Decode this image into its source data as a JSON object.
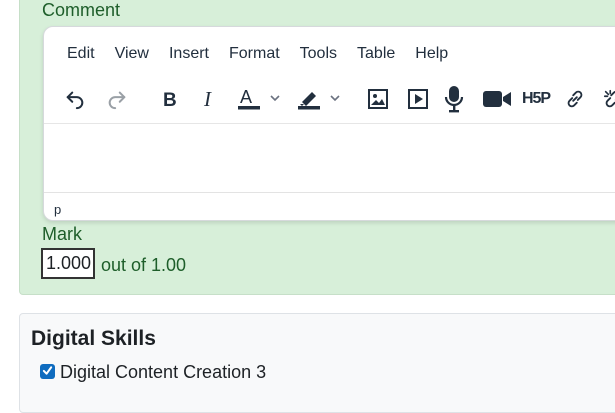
{
  "comment_label": "Comment",
  "editor": {
    "menu": [
      "Edit",
      "View",
      "Insert",
      "Format",
      "Tools",
      "Table",
      "Help"
    ],
    "toolbar": [
      "undo-icon",
      "redo-icon",
      "bold-icon",
      "italic-icon",
      "text-color-icon",
      "highlight-color-icon",
      "image-icon",
      "media-icon",
      "record-audio-icon",
      "record-video-icon",
      "h5p-icon",
      "link-icon",
      "unlink-icon"
    ],
    "h5p_text": "H5P",
    "status_path": "p"
  },
  "mark": {
    "label": "Mark",
    "value": "1.000",
    "out_of": "out of 1.00"
  },
  "skills": {
    "title": "Digital Skills",
    "items": [
      {
        "label": "Digital Content Creation 3",
        "checked": true
      }
    ]
  },
  "colors": {
    "panel_bg": "#d7efd9",
    "label_green": "#1e5e2a",
    "checkbox_blue": "#0f6cbf"
  }
}
